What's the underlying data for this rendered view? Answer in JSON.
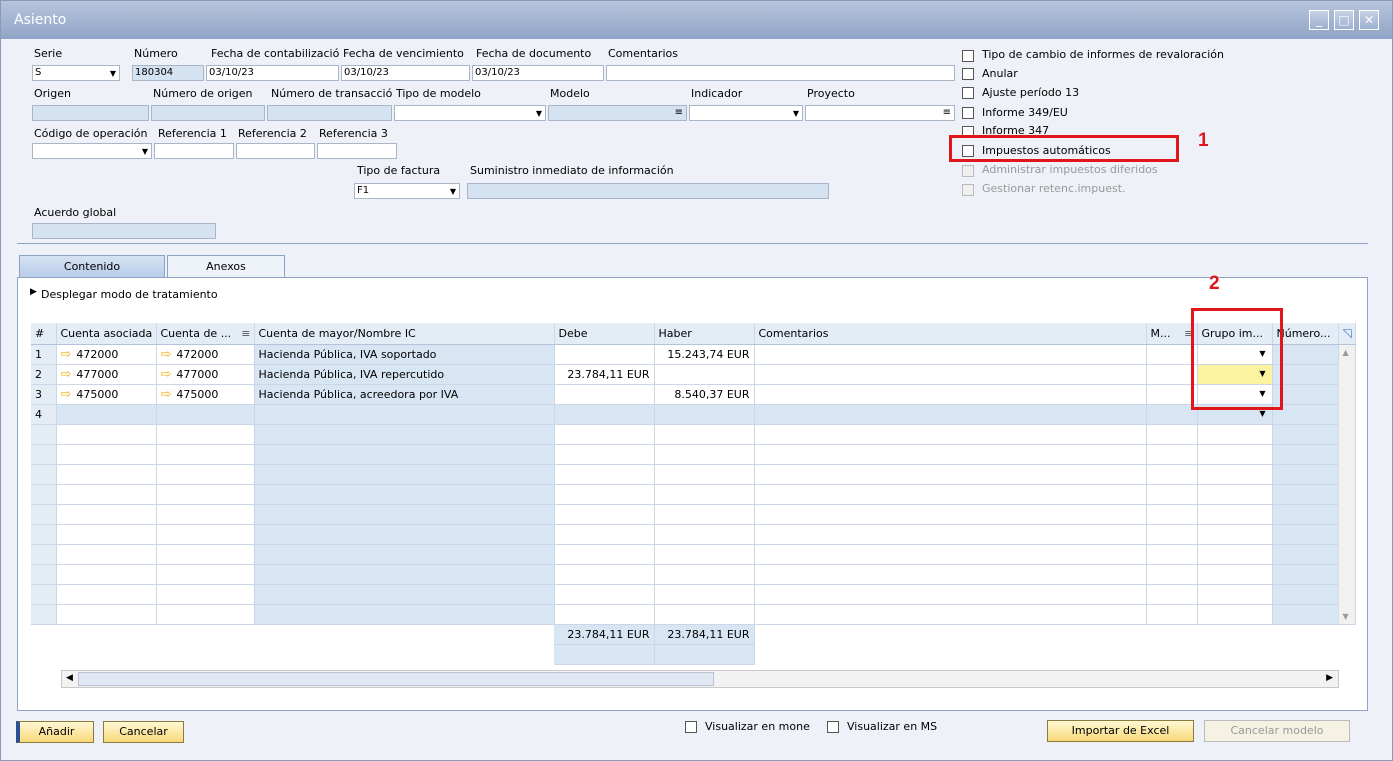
{
  "window": {
    "title": "Asiento",
    "controls": [
      "_",
      "□",
      "✕"
    ]
  },
  "header": {
    "labels": {
      "serie": "Serie",
      "numero": "Número",
      "fecha_contab": "Fecha de contabilizació",
      "fecha_venc": "Fecha de vencimiento",
      "fecha_doc": "Fecha de documento",
      "comentarios": "Comentarios",
      "origen": "Origen",
      "numero_origen": "Número de origen",
      "numero_trans": "Número de transacció",
      "tipo_modelo": "Tipo de modelo",
      "modelo": "Modelo",
      "indicador": "Indicador",
      "proyecto": "Proyecto",
      "codigo_op": "Código de operación",
      "ref1": "Referencia 1",
      "ref2": "Referencia 2",
      "ref3": "Referencia 3",
      "tipo_factura": "Tipo de factura",
      "suministro": "Suministro inmediato de información",
      "acuerdo": "Acuerdo global"
    },
    "values": {
      "serie": "S",
      "numero": "180304",
      "fecha_contab": "03/10/23",
      "fecha_venc": "03/10/23",
      "fecha_doc": "03/10/23",
      "tipo_factura": "F1"
    }
  },
  "checkboxes": [
    {
      "label": "Tipo de cambio de informes de revaloración",
      "disabled": false
    },
    {
      "label": "Anular",
      "disabled": false
    },
    {
      "label": "Ajuste período 13",
      "disabled": false
    },
    {
      "label": "Informe 349/EU",
      "disabled": false
    },
    {
      "label": "Informe 347",
      "disabled": false
    },
    {
      "label": "Impuestos automáticos",
      "disabled": false
    },
    {
      "label": "Administrar impuestos diferidos",
      "disabled": true
    },
    {
      "label": "Gestionar retenc.impuest.",
      "disabled": true
    }
  ],
  "annotations": {
    "one": "1",
    "two": "2"
  },
  "tabs": [
    {
      "label": "Contenido",
      "active": true
    },
    {
      "label": "Anexos",
      "active": false
    }
  ],
  "expand_label": "Desplegar modo de tratamiento",
  "grid": {
    "columns": [
      "#",
      "Cuenta asociada",
      "Cuenta de ...",
      "Cuenta de mayor/Nombre IC",
      "Debe",
      "Haber",
      "Comentarios",
      "M...",
      "Grupo im...",
      "Número..."
    ],
    "rows": [
      {
        "n": "1",
        "asociada": "472000",
        "cuenta": "472000",
        "nombre": "Hacienda Pública, IVA soportado",
        "debe": "",
        "haber": "15.243,74 EUR"
      },
      {
        "n": "2",
        "asociada": "477000",
        "cuenta": "477000",
        "nombre": "Hacienda Pública, IVA repercutido",
        "debe": "23.784,11 EUR",
        "haber": ""
      },
      {
        "n": "3",
        "asociada": "475000",
        "cuenta": "475000",
        "nombre": "Hacienda Pública, acreedora por IVA",
        "debe": "",
        "haber": "8.540,37 EUR"
      },
      {
        "n": "4",
        "asociada": "",
        "cuenta": "",
        "nombre": "",
        "debe": "",
        "haber": ""
      }
    ],
    "totals": {
      "debe": "23.784,11 EUR",
      "haber": "23.784,11 EUR"
    }
  },
  "footer": {
    "add": "Añadir",
    "cancel": "Cancelar",
    "visualizar_moneda": "Visualizar en monе",
    "visualizar_ms": "Visualizar en MS",
    "import": "Importar de Excel",
    "cancel_model": "Cancelar modelo"
  },
  "colors": {
    "red_annotation": "#e0161b",
    "button_gold": "#f8d97a",
    "readonly_blue": "#d5e2f1"
  }
}
